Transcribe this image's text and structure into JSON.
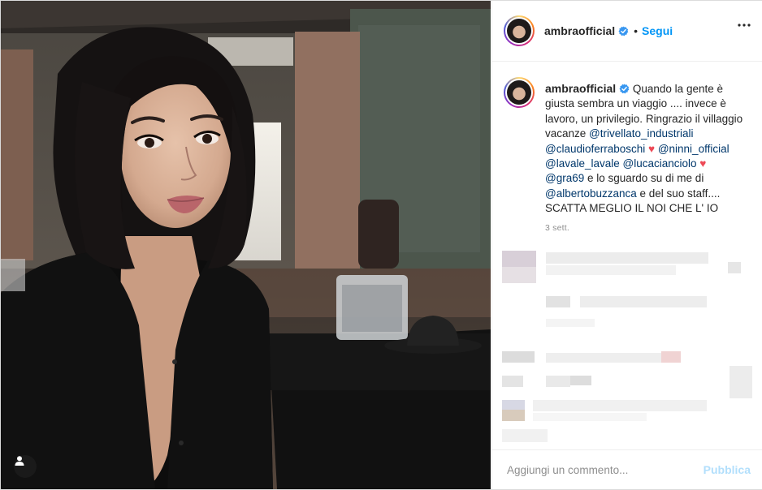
{
  "post": {
    "username": "ambraofficial",
    "follow_separator": "•",
    "follow_label": "Segui",
    "caption": {
      "username": "ambraofficial",
      "segments": [
        {
          "text": " Quando la gente è giusta sembra un viaggio .... invece è lavoro, un privilegio. Ringrazio il villaggio vacanze ",
          "type": "text"
        },
        {
          "text": "@trivellato_industriali",
          "type": "tag"
        },
        {
          "text": " ",
          "type": "text"
        },
        {
          "text": "@claudioferraboschi",
          "type": "tag"
        },
        {
          "text": " ",
          "type": "text"
        },
        {
          "text": "♥",
          "type": "emoji"
        },
        {
          "text": " ",
          "type": "text"
        },
        {
          "text": "@ninni_official",
          "type": "tag"
        },
        {
          "text": " ",
          "type": "text"
        },
        {
          "text": "@lavale_lavale",
          "type": "tag"
        },
        {
          "text": " ",
          "type": "text"
        },
        {
          "text": "@lucacianciolo",
          "type": "tag"
        },
        {
          "text": " ",
          "type": "text"
        },
        {
          "text": "♥",
          "type": "emoji"
        },
        {
          "text": " ",
          "type": "text"
        },
        {
          "text": "@gra69",
          "type": "tag"
        },
        {
          "text": " e lo sguardo su di me di ",
          "type": "text"
        },
        {
          "text": "@albertobuzzanca",
          "type": "tag"
        },
        {
          "text": " e del suo staff.... SCATTA MEGLIO IL NOI CHE L' IO",
          "type": "text"
        }
      ],
      "time": "3 sett."
    },
    "comment_placeholder": "Aggiungi un commento...",
    "publish_label": "Pubblica"
  },
  "icons": {
    "verified": "verified-badge-icon",
    "more": "more-options-icon",
    "user_tag": "user-tag-icon",
    "heart": "heart-emoji-icon"
  },
  "colors": {
    "link_blue": "#0095f6",
    "tag_blue": "#00376b",
    "publish_disabled": "#b2dffc",
    "heart": "#ed4956"
  }
}
